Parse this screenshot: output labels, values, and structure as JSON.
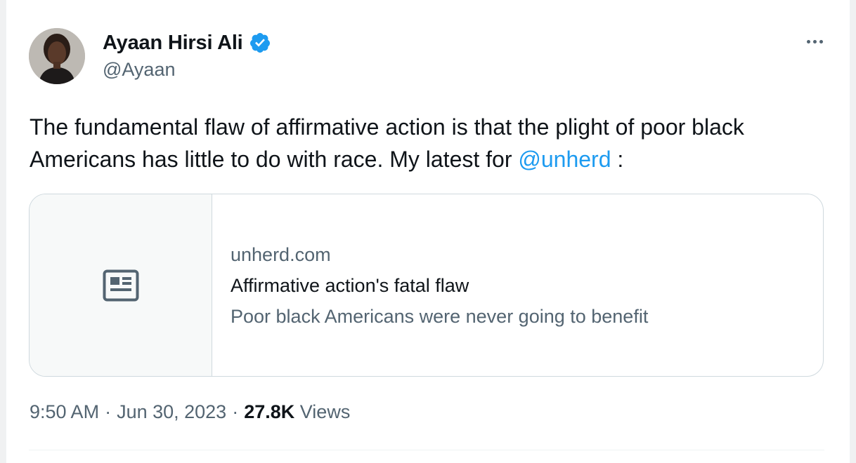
{
  "author": {
    "display_name": "Ayaan Hirsi Ali",
    "handle": "@Ayaan",
    "verified": true,
    "avatar_icon": "profile-photo"
  },
  "tweet": {
    "text_before": "The fundamental flaw of affirmative action is that the plight of poor black Americans has little to do with race. My latest for ",
    "mention": "@unherd",
    "text_after": " :"
  },
  "link_card": {
    "icon": "article-icon",
    "domain": "unherd.com",
    "title": "Affirmative action's fatal flaw",
    "description": "Poor black Americans were never going to benefit"
  },
  "meta": {
    "time": "9:50 AM",
    "separator": "·",
    "date": "Jun 30, 2023",
    "views_count": "27.8K",
    "views_label": "Views"
  },
  "colors": {
    "accent": "#1d9bf0",
    "text_primary": "#0f1419",
    "text_secondary": "#536471",
    "border": "#cfd9de"
  }
}
